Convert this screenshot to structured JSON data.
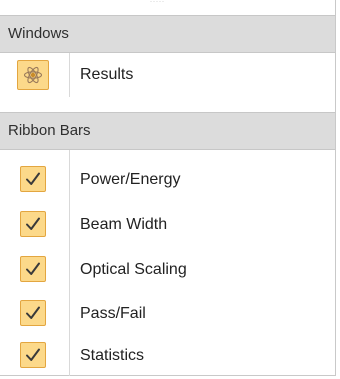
{
  "sections": {
    "windows": {
      "title": "Windows",
      "items": [
        {
          "label": "Results",
          "icon": "results-atom-icon",
          "checked": true
        }
      ]
    },
    "ribbon_bars": {
      "title": "Ribbon Bars",
      "items": [
        {
          "label": "Power/Energy",
          "checked": true
        },
        {
          "label": "Beam Width",
          "checked": true
        },
        {
          "label": "Optical Scaling",
          "checked": true
        },
        {
          "label": "Pass/Fail",
          "checked": true
        },
        {
          "label": "Statistics",
          "checked": true
        }
      ]
    }
  },
  "colors": {
    "header_bg": "#dcdcdc",
    "check_bg": "#fcd98a",
    "check_border": "#e3a640",
    "check_mark": "#3a3a3a",
    "text": "#222222"
  }
}
